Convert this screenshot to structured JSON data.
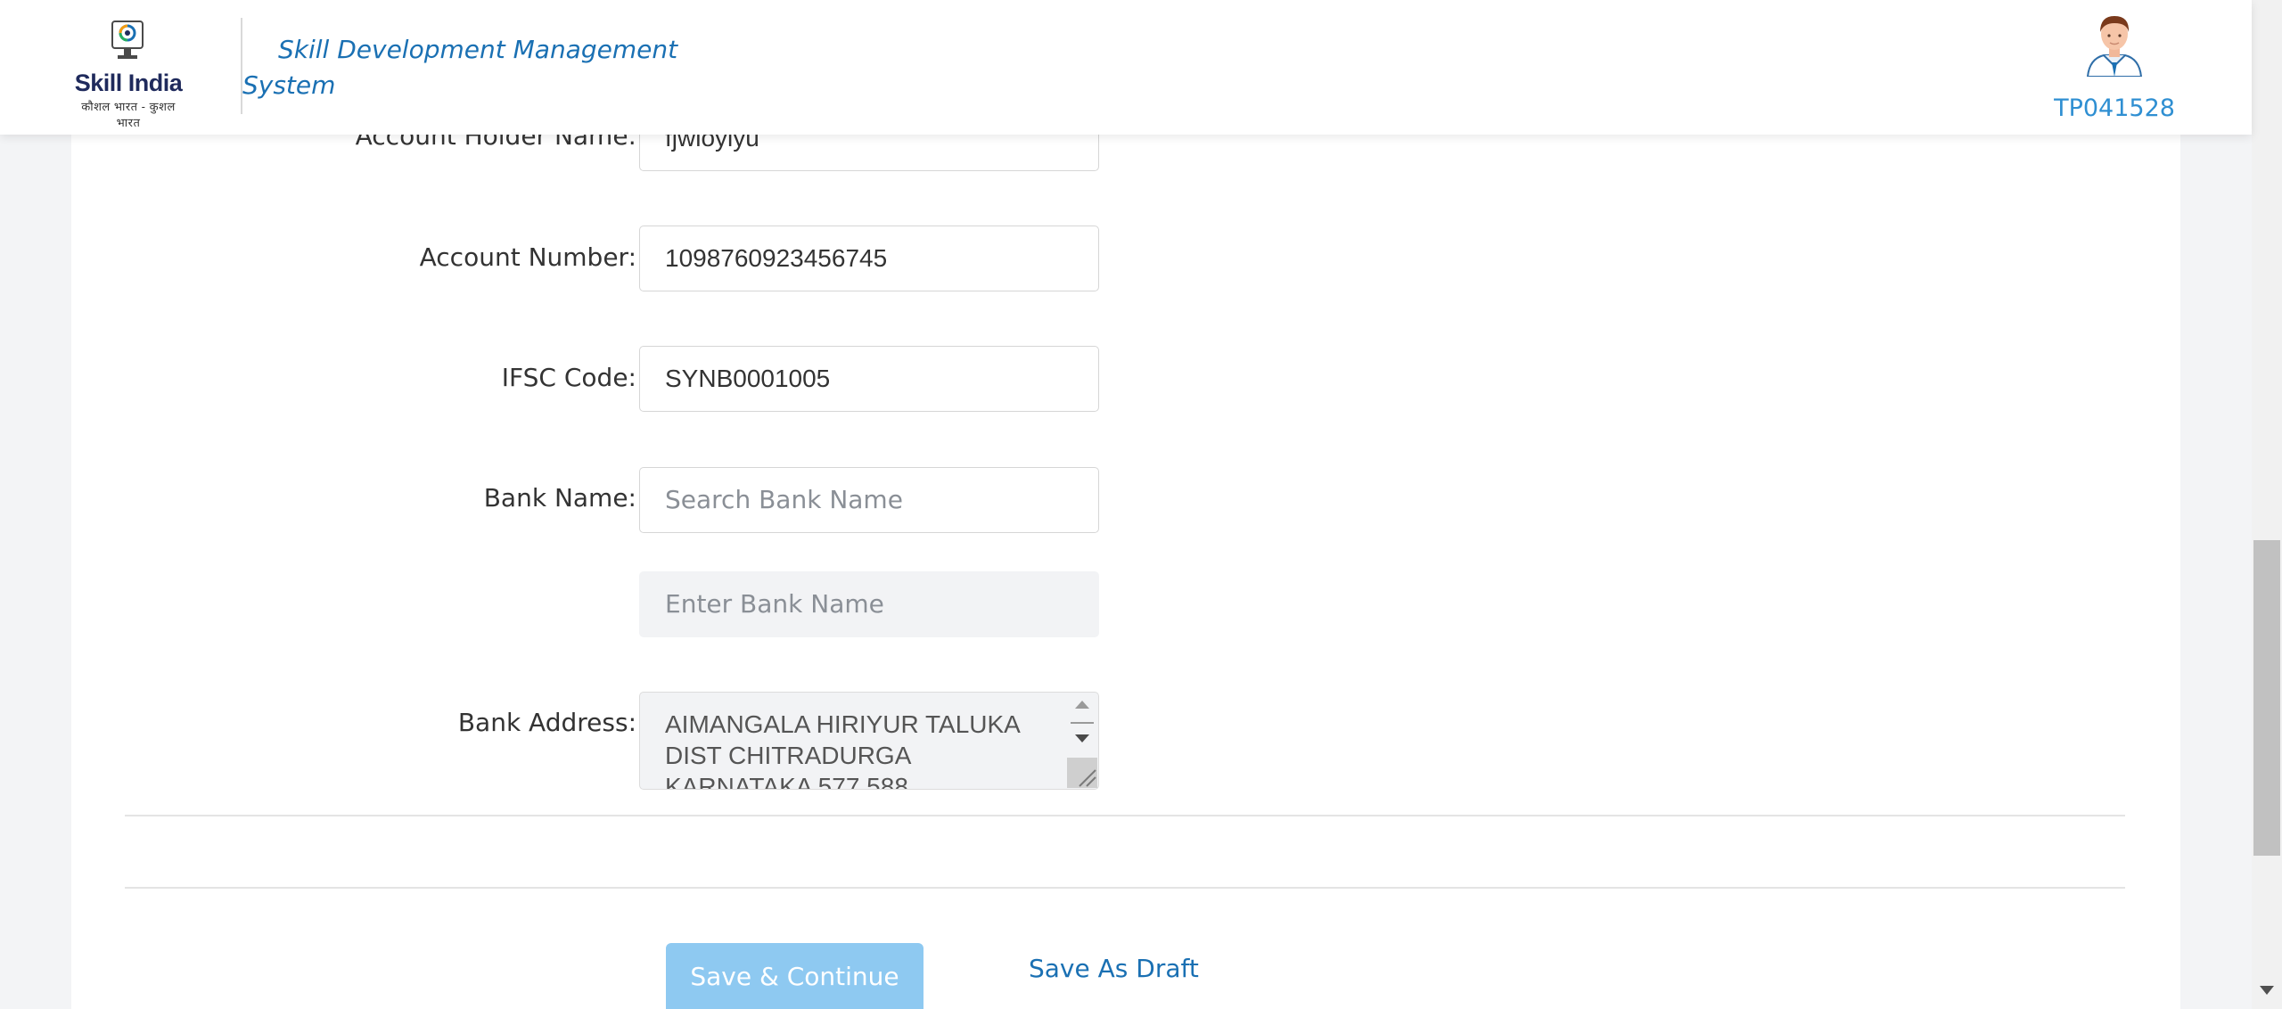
{
  "header": {
    "logo_text": "Skill India",
    "logo_tagline": "कौशल भारत - कुशल भारत",
    "system_name": "Skill Development Management System",
    "user_id": "TP041528"
  },
  "form": {
    "account_holder": {
      "label": "Account Holder Name:",
      "value": "fjwloylyu"
    },
    "account_number": {
      "label": "Account Number:",
      "value": "1098760923456745"
    },
    "ifsc": {
      "label": "IFSC Code:",
      "value": "SYNB0001005"
    },
    "bank_name": {
      "label": "Bank Name:",
      "placeholder": "Search Bank Name"
    },
    "bank_name_manual": {
      "placeholder": "Enter Bank Name"
    },
    "bank_address": {
      "label": "Bank Address:",
      "value": "AIMANGALA HIRIYUR TALUKA DIST CHITRADURGA KARNATAKA 577 588"
    },
    "required_marker": "*"
  },
  "actions": {
    "save_continue_label": "Save & Continue",
    "save_draft_label": "Save As Draft"
  },
  "colors": {
    "brand_blue": "#1a70b3",
    "required_red": "#e02020",
    "primary_button": "#8ec9f1"
  }
}
